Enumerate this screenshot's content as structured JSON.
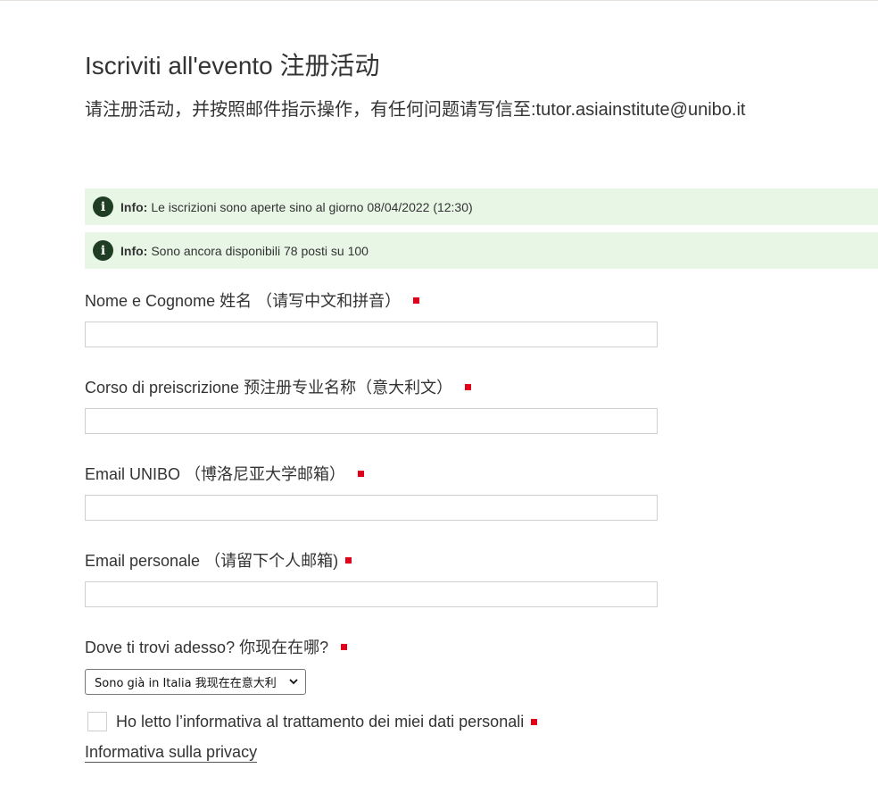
{
  "header": {
    "title": "Iscriviti all'evento 注册活动",
    "subtitle": "请注册活动，并按照邮件指示操作，有任何问题请写信至:tutor.asiainstitute@unibo.it"
  },
  "info_boxes": [
    {
      "label": "Info:",
      "text": "Le iscrizioni sono aperte sino al giorno 08/04/2022 (12:30)",
      "icon": "info-icon"
    },
    {
      "label": "Info:",
      "text": "Sono ancora disponibili 78 posti su 100",
      "icon": "info-icon"
    }
  ],
  "form": {
    "fields": [
      {
        "label": "Nome e Cognome 姓名 （请写中文和拼音）",
        "value": "",
        "required": true
      },
      {
        "label": "Corso di preiscrizione 预注册专业名称（意大利文）",
        "value": "",
        "required": true
      },
      {
        "label": "Email UNIBO （博洛尼亚大学邮箱）",
        "value": "",
        "required": true
      },
      {
        "label": "Email personale （请留下个人邮箱)",
        "value": "",
        "required": true
      }
    ],
    "location": {
      "label": "Dove ti trovi adesso? 你现在在哪?",
      "selected": "Sono già in Italia 我现在在意大利",
      "required": true
    },
    "consent": {
      "label": "Ho letto l’informativa al trattamento dei miei dati personali",
      "checked": false,
      "required": true
    },
    "privacy_link": "Informativa sulla privacy"
  },
  "colors": {
    "info_bg": "#e8f6e6",
    "info_icon": "#1f3d23",
    "required_marker": "#e0001b"
  }
}
